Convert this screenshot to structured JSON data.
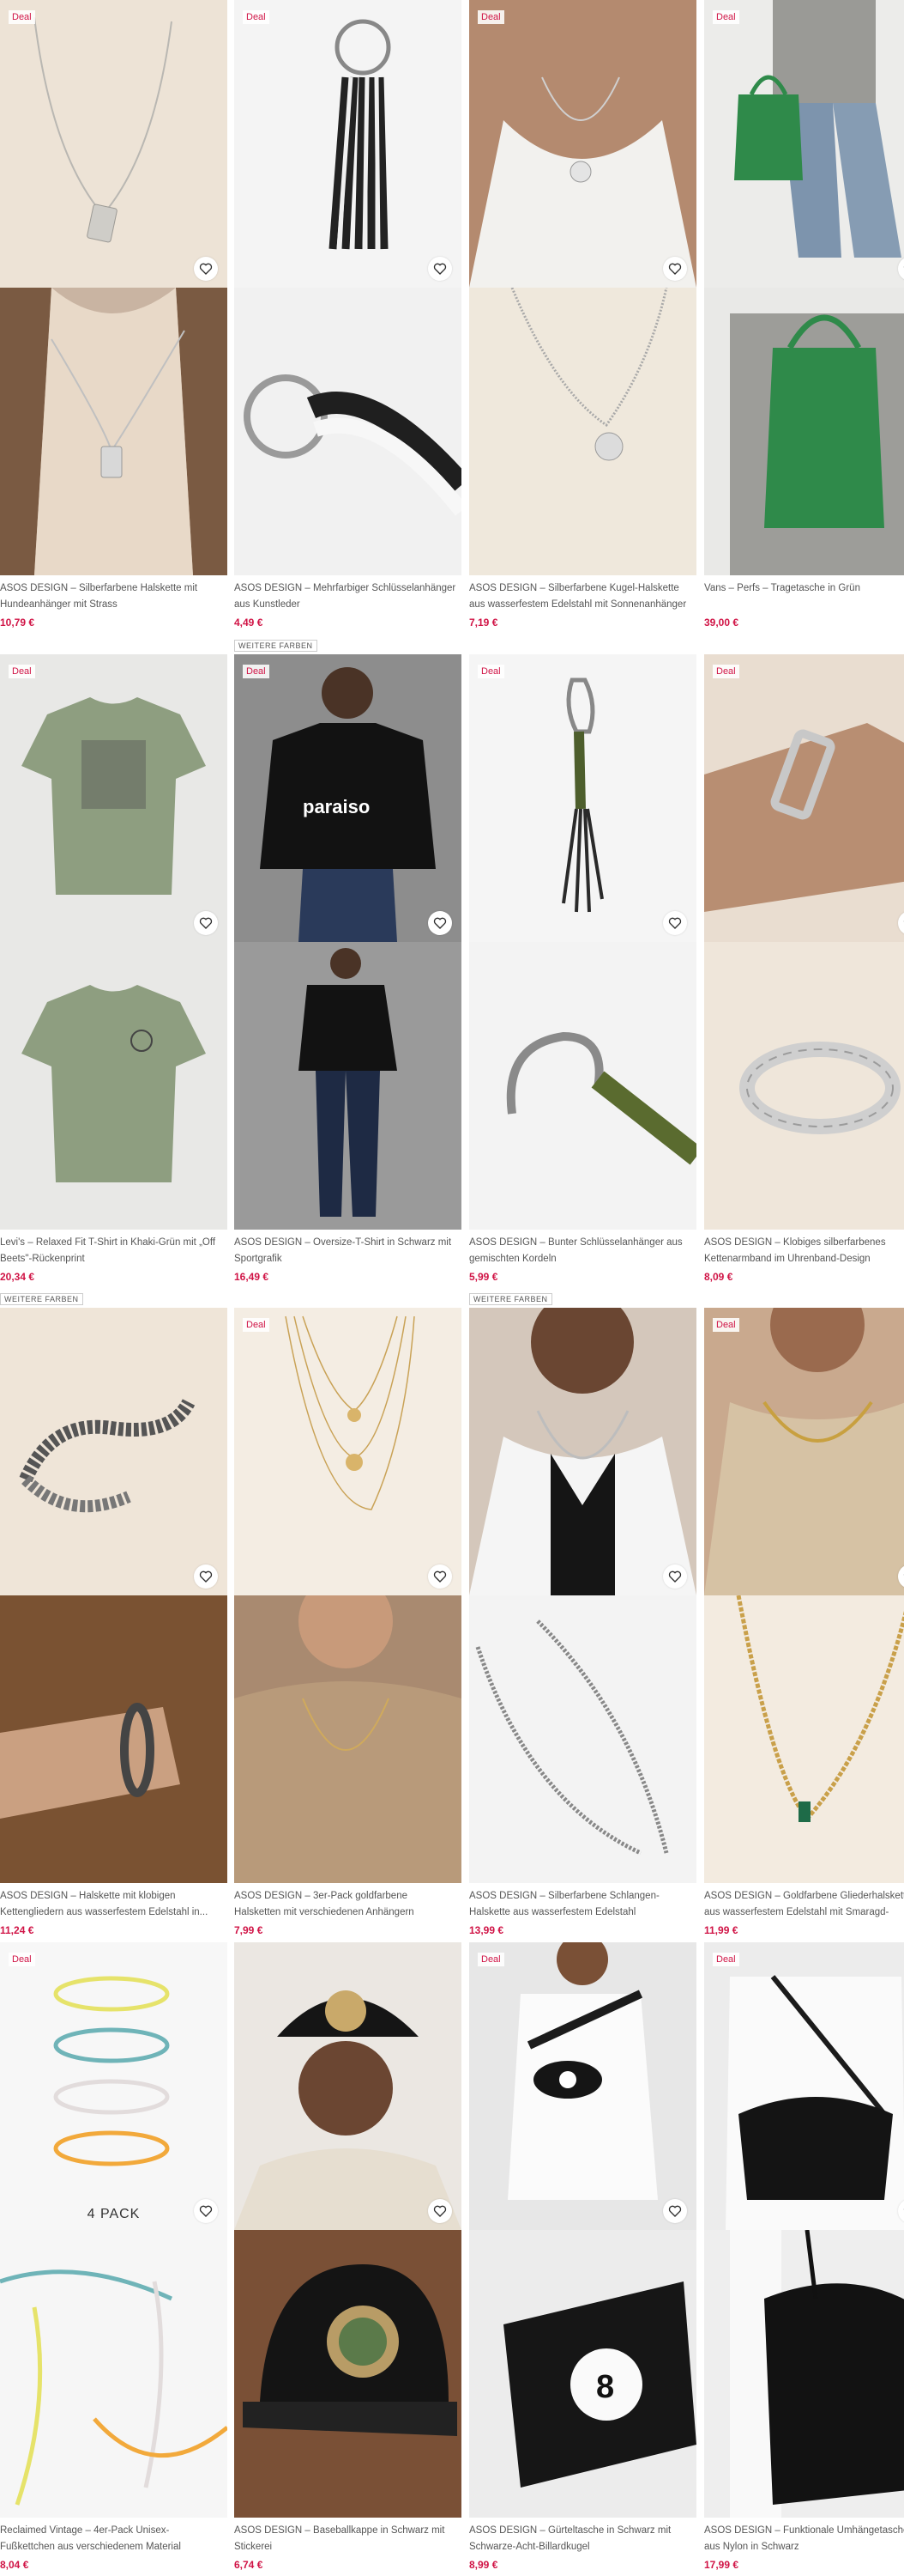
{
  "badges": {
    "deal": "Deal",
    "more_colors": "WEITERE FARBEN"
  },
  "products": [
    {
      "title": "ASOS DESIGN – Silberfarbene Halskette mit Hundeanhänger mit Strass",
      "price": "10,79 €",
      "deal": true
    },
    {
      "title": "ASOS DESIGN – Mehrfarbiger Schlüsselanhänger aus Kunstleder",
      "price": "4,49 €",
      "deal": true
    },
    {
      "title": "ASOS DESIGN – Silberfarbene Kugel-Halskette aus wasserfestem Edelstahl mit Sonnenanhänger",
      "price": "7,19 €",
      "deal": true
    },
    {
      "title": "Vans – Perfs – Tragetasche in Grün",
      "price": "39,00 €",
      "deal": true
    },
    {
      "title": "Levi's – Relaxed Fit T-Shirt in Khaki-Grün mit „Off Beets\"-Rückenprint",
      "price": "20,34 €",
      "deal": true
    },
    {
      "title": "ASOS DESIGN – Oversize-T-Shirt in Schwarz mit Sportgrafik",
      "price": "16,49 €",
      "deal": true
    },
    {
      "title": "ASOS DESIGN – Bunter Schlüsselanhänger aus gemischten Kordeln",
      "price": "5,99 €",
      "deal": true
    },
    {
      "title": "ASOS DESIGN – Klobiges silberfarbenes Kettenarmband im Uhrenband-Design",
      "price": "8,09 €",
      "deal": true
    },
    {
      "title": "ASOS DESIGN – Halskette mit klobigen Kettengliedern aus wasserfestem Edelstahl in...",
      "price": "11,24 €",
      "deal": true
    },
    {
      "title": "ASOS DESIGN – 3er-Pack goldfarbene Halsketten mit verschiedenen Anhängern",
      "price": "7,99 €",
      "deal": true
    },
    {
      "title": "ASOS DESIGN – Silberfarbene Schlangen-Halskette aus wasserfestem Edelstahl",
      "price": "13,99 €",
      "deal": false
    },
    {
      "title": "ASOS DESIGN – Goldfarbene Gliederhalskette aus wasserfestem Edelstahl mit Smaragd-Schmuckstein",
      "price": "11,99 €",
      "deal": true
    },
    {
      "title": "Reclaimed Vintage – 4er-Pack Unisex-Fußkettchen aus verschiedenem Material",
      "price": "8,04 €",
      "deal": true,
      "pack_label": "4 PACK"
    },
    {
      "title": "ASOS DESIGN – Baseballkappe in Schwarz mit Stickerei",
      "price": "6,74 €",
      "deal": false
    },
    {
      "title": "ASOS DESIGN – Gürteltasche in Schwarz mit Schwarze-Acht-Billardkugel",
      "price": "8,99 €",
      "deal": true
    },
    {
      "title": "ASOS DESIGN – Funktionale Umhängetasche aus Nylon in Schwarz",
      "price": "17,99 €",
      "deal": true
    }
  ],
  "icons": {
    "wishlist": "heart-outline-icon"
  },
  "colors": {
    "price": "#d01345",
    "deal": "#d01345"
  }
}
